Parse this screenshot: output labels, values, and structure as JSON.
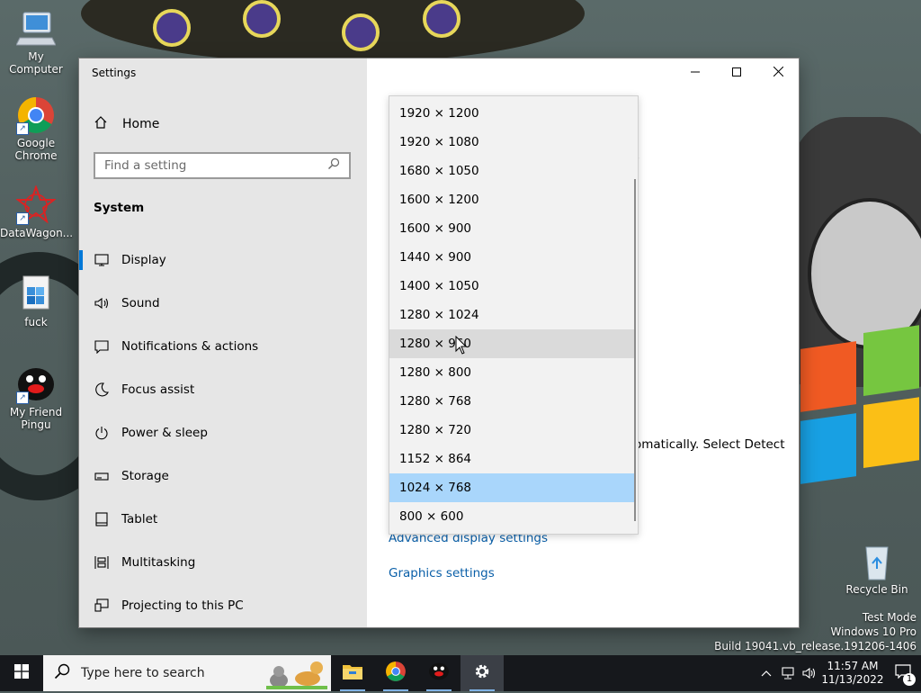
{
  "desktop": {
    "icons": [
      {
        "label": "My Computer",
        "icon": "computer-icon"
      },
      {
        "label": "Google Chrome",
        "icon": "chrome-icon"
      },
      {
        "label": "DataWagon...",
        "icon": "datawagon-icon"
      },
      {
        "label": "fuck",
        "icon": "installer-icon"
      },
      {
        "label": "My Friend Pingu",
        "icon": "pingu-icon"
      }
    ],
    "recycle_bin": {
      "label": "Recycle Bin",
      "icon": "recycle-bin-icon"
    },
    "watermark": {
      "line1": "Test Mode",
      "line2": "Windows 10 Pro",
      "line3": "Build 19041.vb_release.191206-1406"
    }
  },
  "window": {
    "title": "Settings",
    "controls": {
      "minimize": "minimize-icon",
      "maximize": "maximize-icon",
      "close": "close-icon"
    },
    "sidebar": {
      "home_label": "Home",
      "search_placeholder": "Find a setting",
      "section_label": "System",
      "items": [
        {
          "label": "Display",
          "icon": "monitor-icon",
          "active": true
        },
        {
          "label": "Sound",
          "icon": "speaker-icon"
        },
        {
          "label": "Notifications & actions",
          "icon": "notification-icon"
        },
        {
          "label": "Focus assist",
          "icon": "moon-icon"
        },
        {
          "label": "Power & sleep",
          "icon": "power-icon"
        },
        {
          "label": "Storage",
          "icon": "storage-icon"
        },
        {
          "label": "Tablet",
          "icon": "tablet-icon"
        },
        {
          "label": "Multitasking",
          "icon": "multitasking-icon"
        },
        {
          "label": "Projecting to this PC",
          "icon": "projecting-icon"
        }
      ]
    },
    "content": {
      "partial_text_1": "s",
      "partial_text_2": "omatically. Select Detect",
      "links": {
        "advanced": "Advanced display settings",
        "graphics": "Graphics settings"
      },
      "resolution_dropdown": {
        "options": [
          "1920 × 1200",
          "1920 × 1080",
          "1680 × 1050",
          "1600 × 1200",
          "1600 × 900",
          "1440 × 900",
          "1400 × 1050",
          "1280 × 1024",
          "1280 × 960",
          "1280 × 800",
          "1280 × 768",
          "1280 × 720",
          "1152 × 864",
          "1024 × 768",
          "800 × 600"
        ],
        "selected": "1024 × 768",
        "hovered": "1280 × 960"
      }
    }
  },
  "taskbar": {
    "search_placeholder": "Type here to search",
    "apps": [
      {
        "name": "File Explorer",
        "icon": "folder-icon"
      },
      {
        "name": "Google Chrome",
        "icon": "chrome-icon"
      },
      {
        "name": "Pingu",
        "icon": "pingu-icon"
      },
      {
        "name": "Settings",
        "icon": "gear-icon",
        "active": true
      }
    ],
    "clock": {
      "time": "11:57 AM",
      "date": "11/13/2022"
    },
    "notifications_count": "1"
  }
}
